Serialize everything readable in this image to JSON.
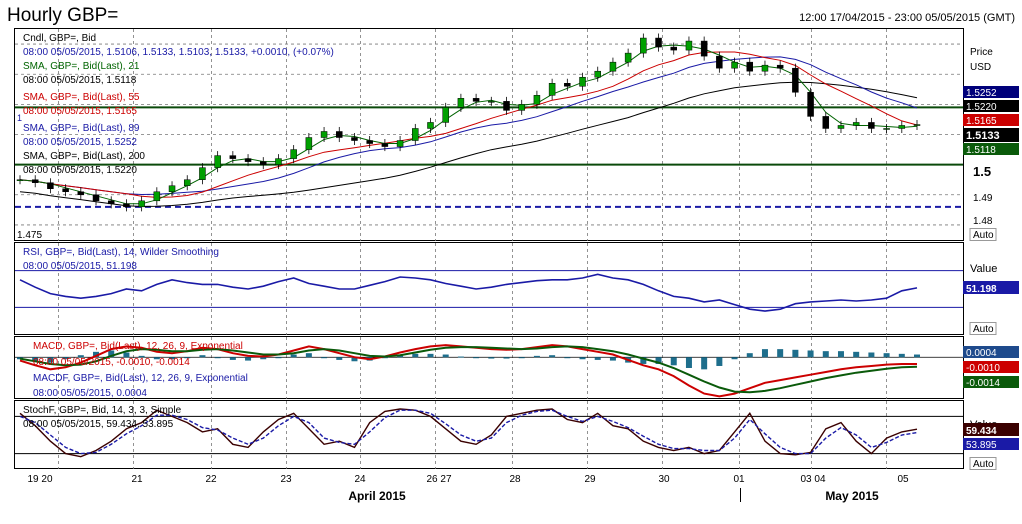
{
  "header": {
    "title": "Hourly GBP=",
    "range": "12:00 17/04/2015 - 23:00 05/05/2015 (GMT)"
  },
  "main_panel": {
    "legend": [
      {
        "text": "Cndl, GBP=, Bid",
        "color": "#000000"
      },
      {
        "text": "08:00 05/05/2015, 1.5106, 1.5133, 1.5103, 1.5133, +0.0010, (+0.07%)",
        "color": "#1a1aa6"
      },
      {
        "text": "SMA, GBP=, Bid(Last), 21",
        "color": "#006400"
      },
      {
        "text": "08:00 05/05/2015, 1.5118",
        "color": "#000000"
      },
      {
        "text": "SMA, GBP=, Bid(Last), 55",
        "color": "#cc0000"
      },
      {
        "text": "08:00 05/05/2015, 1.5165",
        "color": "#cc0000"
      },
      {
        "text": "SMA, GBP=, Bid(Last), 89",
        "color": "#1a1aa6"
      },
      {
        "text": "08:00 05/05/2015, 1.5252",
        "color": "#1a1aa6"
      },
      {
        "text": "SMA, GBP=, Bid(Last), 200",
        "color": "#000000"
      },
      {
        "text": "08:00 05/05/2015, 1.5220",
        "color": "#000000"
      }
    ],
    "axis_title": "Price",
    "axis_unit": "USD",
    "ticks": [
      "1.5",
      "1.49",
      "1.48"
    ],
    "low_label": "1.475",
    "auto_label": "Auto",
    "badges": [
      {
        "value": "1.5252",
        "bg": "#00007a",
        "fg": "#ffffff"
      },
      {
        "value": "1.5220",
        "bg": "#000000",
        "fg": "#ffffff"
      },
      {
        "value": "1.5165",
        "bg": "#cc0000",
        "fg": "#ffffff"
      },
      {
        "value": "1.5133",
        "bg": "#000000",
        "fg": "#ffffff"
      },
      {
        "value": "1.5118",
        "bg": "#0a5a0a",
        "fg": "#ffffff"
      }
    ],
    "marker": "1"
  },
  "rsi_panel": {
    "legend": [
      {
        "text": "RSI, GBP=, Bid(Last), 14, Wilder Smoothing",
        "color": "#1a1aa6"
      },
      {
        "text": "08:00 05/05/2015, 51.198",
        "color": "#1a1aa6"
      }
    ],
    "axis_title": "Value",
    "badge": "51.198",
    "auto_label": "Auto"
  },
  "macd_panel": {
    "legend": [
      {
        "text": "MACD, GBP=, Bid(Last), 12, 26, 9, Exponential",
        "color": "#cc0000"
      },
      {
        "text": "08:00 05/05/2015, -0.0010, -0.0014",
        "color": "#cc0000"
      },
      {
        "text": "MACDF, GBP=, Bid(Last), 12, 26, 9, Exponential",
        "color": "#1a1aa6"
      },
      {
        "text": "08:00 05/05/2015, 0.0004",
        "color": "#1a1aa6"
      }
    ],
    "badges": [
      {
        "value": "0.0004",
        "bg": "#1e4a8c",
        "fg": "#ffffff"
      },
      {
        "value": "-0.0010",
        "bg": "#cc0000",
        "fg": "#ffffff"
      },
      {
        "value": "-0.0014",
        "bg": "#0a5a0a",
        "fg": "#ffffff"
      }
    ]
  },
  "stoch_panel": {
    "legend": [
      {
        "text": "StochF, GBP=, Bid, 14, 3, 3, Simple",
        "color": "#000000"
      },
      {
        "text": "08:00 05/05/2015, 59.434, 53.895",
        "color": "#000000"
      }
    ],
    "axis_title": "Value",
    "badges": [
      {
        "value": "59.434",
        "bg": "#3a0000",
        "fg": "#ffffff"
      },
      {
        "value": "53.895",
        "bg": "#1a1aa6",
        "fg": "#ffffff"
      }
    ],
    "auto_label": "Auto"
  },
  "x_axis": {
    "day_labels": [
      "19 20",
      "21",
      "22",
      "23",
      "24",
      "26 27",
      "28",
      "29",
      "30",
      "01",
      "03 04",
      "05"
    ],
    "month_labels": [
      "April 2015",
      "May 2015"
    ]
  },
  "colors": {
    "candle_up": "#00a000",
    "candle_down": "#000000",
    "sma21": "#006400",
    "sma55": "#cc0000",
    "sma89": "#1a1aa6",
    "sma200": "#000000",
    "rsi": "#1a1aa6",
    "macd": "#cc0000",
    "signal": "#0a5a0a",
    "macd_hist": "#1e6e8c",
    "stoch_k": "#3a0000",
    "stoch_d": "#1a1aa6"
  },
  "chart_data": {
    "type": "line",
    "days": [
      "19",
      "20",
      "21",
      "22",
      "23",
      "24",
      "26",
      "27",
      "28",
      "29",
      "30",
      "01",
      "03",
      "04",
      "05"
    ],
    "y_range": [
      1.475,
      1.545
    ],
    "price_close": [
      1.495,
      1.494,
      1.492,
      1.491,
      1.49,
      1.488,
      1.487,
      1.486,
      1.488,
      1.491,
      1.493,
      1.495,
      1.499,
      1.503,
      1.502,
      1.501,
      1.5,
      1.502,
      1.505,
      1.509,
      1.511,
      1.509,
      1.508,
      1.507,
      1.506,
      1.508,
      1.512,
      1.514,
      1.519,
      1.522,
      1.521,
      1.521,
      1.518,
      1.52,
      1.523,
      1.527,
      1.526,
      1.529,
      1.531,
      1.534,
      1.537,
      1.542,
      1.539,
      1.538,
      1.541,
      1.536,
      1.532,
      1.534,
      1.531,
      1.533,
      1.532,
      1.524,
      1.516,
      1.512,
      1.513,
      1.514,
      1.512,
      1.512,
      1.513,
      1.5133
    ],
    "horizontal_levels": [
      {
        "value": 1.519,
        "style": "solid",
        "color": "#0a4a0a"
      },
      {
        "value": 1.5,
        "style": "solid",
        "color": "#0a4a0a"
      },
      {
        "value": 1.486,
        "style": "dashed",
        "color": "#1a1aa6"
      }
    ],
    "rsi": [
      60,
      52,
      45,
      42,
      40,
      42,
      45,
      50,
      48,
      55,
      60,
      57,
      55,
      55,
      52,
      50,
      53,
      58,
      62,
      56,
      53,
      50,
      50,
      54,
      58,
      63,
      62,
      60,
      56,
      53,
      50,
      52,
      55,
      57,
      59,
      60,
      60,
      62,
      66,
      62,
      60,
      55,
      48,
      42,
      40,
      36,
      38,
      33,
      28,
      26,
      28,
      34,
      36,
      37,
      38,
      37,
      38,
      40,
      48,
      51.198
    ],
    "rsi_levels": [
      70,
      30
    ],
    "macd": [
      -0.0005,
      -0.0012,
      -0.0018,
      -0.0015,
      -0.0008,
      0.0002,
      0.0012,
      0.0016,
      0.0014,
      0.0008,
      0.0006,
      0.0009,
      0.0014,
      0.0012,
      0.0006,
      0.0002,
      0.0001,
      0.0004,
      0.001,
      0.0016,
      0.0012,
      0.0006,
      0.0,
      -0.0003,
      0.0001,
      0.0007,
      0.0012,
      0.0016,
      0.0018,
      0.0016,
      0.0014,
      0.0012,
      0.0011,
      0.0012,
      0.0015,
      0.0018,
      0.0016,
      0.0012,
      0.0008,
      0.0004,
      -0.0004,
      -0.0012,
      -0.0018,
      -0.0028,
      -0.0042,
      -0.0054,
      -0.0058,
      -0.0054,
      -0.0046,
      -0.0038,
      -0.0034,
      -0.003,
      -0.0026,
      -0.0022,
      -0.0018,
      -0.0015,
      -0.0013,
      -0.0011,
      -0.001,
      -0.001
    ],
    "signal": [
      -0.0002,
      -0.0006,
      -0.001,
      -0.0012,
      -0.0011,
      -0.0006,
      0.0002,
      0.0009,
      0.0012,
      0.0011,
      0.0009,
      0.0009,
      0.0011,
      0.0012,
      0.001,
      0.0007,
      0.0004,
      0.0004,
      0.0006,
      0.001,
      0.0012,
      0.001,
      0.0006,
      0.0002,
      0.0001,
      0.0003,
      0.0007,
      0.0011,
      0.0014,
      0.0015,
      0.0015,
      0.0014,
      0.0013,
      0.0012,
      0.0013,
      0.0015,
      0.0016,
      0.0015,
      0.0012,
      0.0009,
      0.0004,
      -0.0002,
      -0.0008,
      -0.0016,
      -0.0026,
      -0.0036,
      -0.0045,
      -0.0051,
      -0.0052,
      -0.005,
      -0.0046,
      -0.0041,
      -0.0036,
      -0.0031,
      -0.0027,
      -0.0023,
      -0.002,
      -0.0017,
      -0.0015,
      -0.0014
    ],
    "macd_hist": [
      -0.0003,
      -0.0006,
      -0.0008,
      -0.0003,
      0.0003,
      0.0008,
      0.001,
      0.0007,
      0.0002,
      -0.0003,
      -0.0003,
      0.0,
      0.0003,
      0.0,
      -0.0004,
      -0.0005,
      -0.0003,
      0.0,
      0.0004,
      0.0006,
      0.0,
      -0.0004,
      -0.0006,
      -0.0005,
      0.0,
      0.0004,
      0.0005,
      0.0005,
      0.0004,
      0.0001,
      -0.0001,
      -0.0002,
      -0.0002,
      0.0,
      0.0002,
      0.0003,
      0.0,
      -0.0003,
      -0.0004,
      -0.0005,
      -0.0008,
      -0.001,
      -0.001,
      -0.0012,
      -0.0016,
      -0.0018,
      -0.0013,
      -0.0003,
      0.0006,
      0.0012,
      0.0012,
      0.0011,
      0.001,
      0.0009,
      0.0009,
      0.0008,
      0.0007,
      0.0006,
      0.0005,
      0.0004
    ],
    "stoch_k": [
      85,
      65,
      40,
      20,
      15,
      25,
      40,
      60,
      70,
      90,
      80,
      70,
      55,
      60,
      35,
      30,
      55,
      75,
      85,
      60,
      35,
      40,
      30,
      70,
      88,
      92,
      90,
      80,
      60,
      40,
      35,
      50,
      80,
      85,
      90,
      92,
      75,
      70,
      85,
      65,
      60,
      40,
      30,
      25,
      30,
      20,
      25,
      55,
      85,
      40,
      20,
      18,
      22,
      60,
      70,
      40,
      20,
      45,
      55,
      59.434
    ],
    "stoch_d": [
      80,
      70,
      50,
      30,
      20,
      22,
      35,
      52,
      65,
      82,
      82,
      75,
      62,
      58,
      45,
      35,
      45,
      65,
      80,
      70,
      45,
      38,
      35,
      55,
      78,
      90,
      90,
      85,
      68,
      50,
      40,
      45,
      70,
      82,
      88,
      90,
      80,
      72,
      80,
      72,
      62,
      48,
      35,
      28,
      28,
      25,
      25,
      45,
      75,
      52,
      30,
      20,
      20,
      45,
      62,
      50,
      30,
      38,
      50,
      53.895
    ],
    "stoch_levels": [
      80,
      20
    ]
  }
}
